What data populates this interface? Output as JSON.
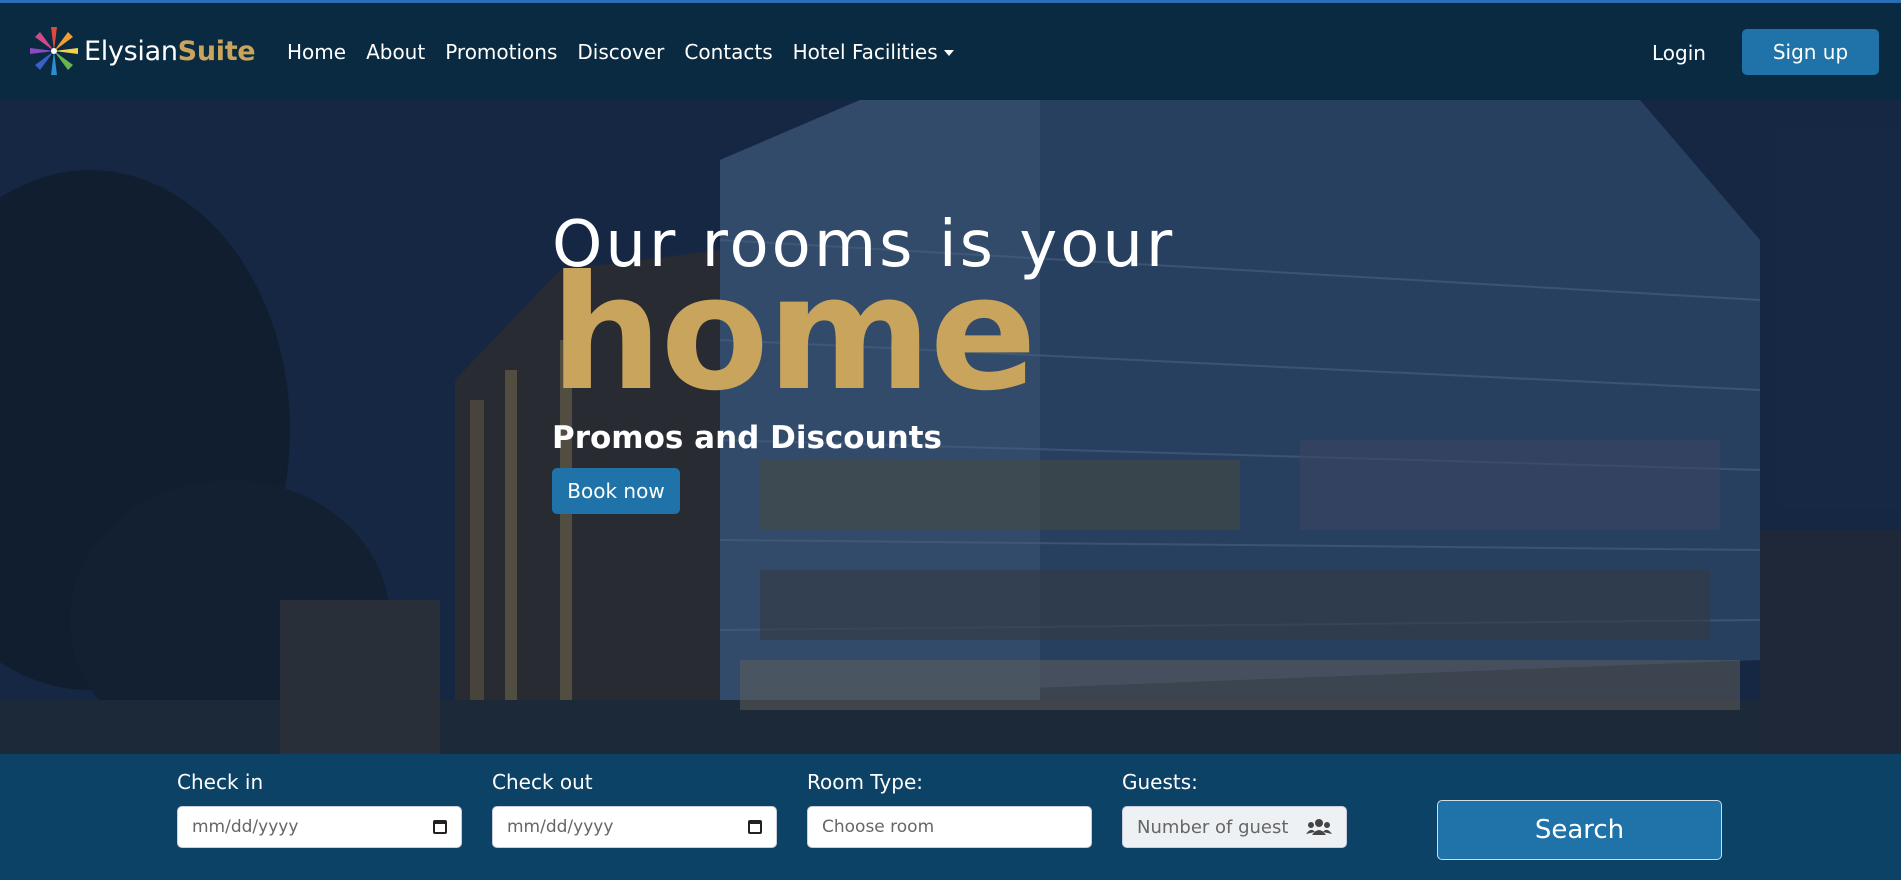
{
  "brand": {
    "part1": "Elysian",
    "part2": "Suite"
  },
  "nav": {
    "items": [
      {
        "label": "Home"
      },
      {
        "label": "About"
      },
      {
        "label": "Promotions"
      },
      {
        "label": "Discover"
      },
      {
        "label": "Contacts"
      },
      {
        "label": "Hotel Facilities"
      }
    ],
    "login": "Login",
    "signup": "Sign up"
  },
  "hero": {
    "title_line1": "Our rooms is your",
    "title_line2": "home",
    "subtitle": "Promos and Discounts",
    "cta": "Book now"
  },
  "booking": {
    "checkin": {
      "label": "Check in",
      "placeholder": "mm/dd/yyyy"
    },
    "checkout": {
      "label": "Check out",
      "placeholder": "mm/dd/yyyy"
    },
    "room_type": {
      "label": "Room Type:",
      "placeholder": "Choose room"
    },
    "guests": {
      "label": "Guests:",
      "placeholder": "Number of guest"
    },
    "search": "Search"
  },
  "colors": {
    "navbar": "#092a40",
    "accent_gold": "#c9a45c",
    "button_blue": "#1f73a8",
    "booking_bar": "#0c4266"
  },
  "icons": [
    "brand-logo-icon",
    "dropdown-caret-icon",
    "calendar-icon",
    "users-icon"
  ]
}
